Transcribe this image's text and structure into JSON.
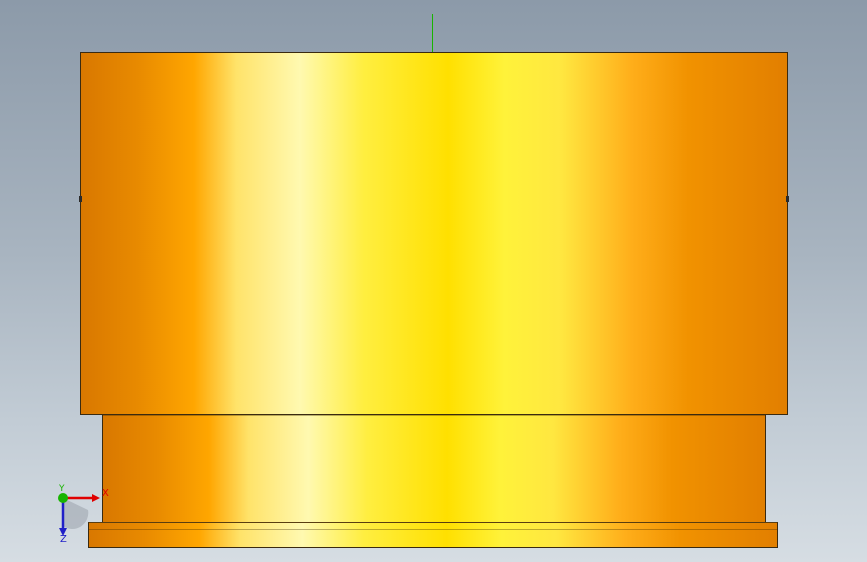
{
  "viewport": {
    "background_top": "#8c9aa9",
    "background_bottom": "#d6dde3"
  },
  "model": {
    "color": "#ffd400",
    "edge_color": "#3a2a10"
  },
  "origin": {
    "axis_color": "#18b400"
  },
  "triad": {
    "x_label": "X",
    "y_label": "Y",
    "z_label": "Z",
    "x_color": "#e00000",
    "y_color": "#18b400",
    "z_color": "#2020c8"
  }
}
